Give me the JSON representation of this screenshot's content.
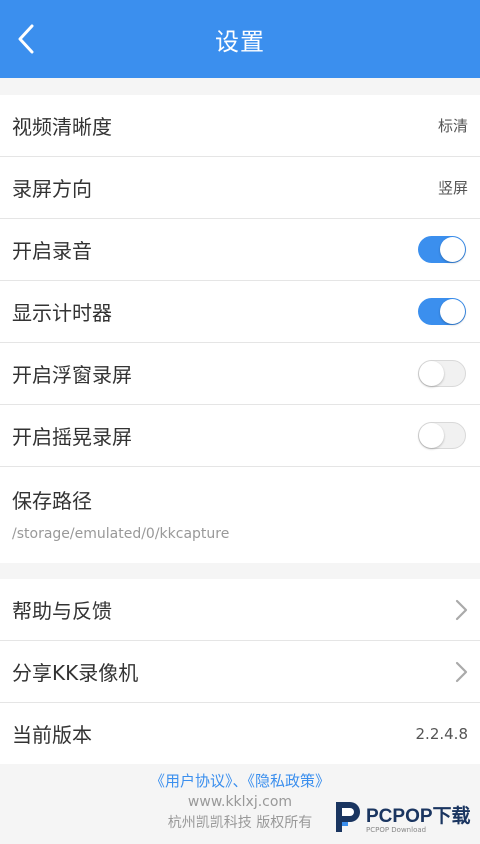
{
  "header": {
    "title": "设置"
  },
  "settings": [
    {
      "label": "视频清晰度",
      "value": "标清"
    },
    {
      "label": "录屏方向",
      "value": "竖屏"
    },
    {
      "label": "开启录音",
      "toggle": true
    },
    {
      "label": "显示计时器",
      "toggle": true
    },
    {
      "label": "开启浮窗录屏",
      "toggle": false
    },
    {
      "label": "开启摇晃录屏",
      "toggle": false
    }
  ],
  "save_path": {
    "label": "保存路径",
    "value": "/storage/emulated/0/kkcapture"
  },
  "more": [
    {
      "label": "帮助与反馈"
    },
    {
      "label": "分享KK录像机"
    },
    {
      "label": "当前版本",
      "value": "2.2.4.8"
    }
  ],
  "footer": {
    "links": "《用户协议》、《隐私政策》",
    "site": "www.kklxj.com",
    "copyright": "杭州凯凯科技 版权所有"
  },
  "watermark": {
    "brand": "PCPOP下载",
    "sub": "PCPOP Download"
  },
  "colors": {
    "accent": "#3b8fee",
    "toggle_off": "#f1f1f1"
  }
}
